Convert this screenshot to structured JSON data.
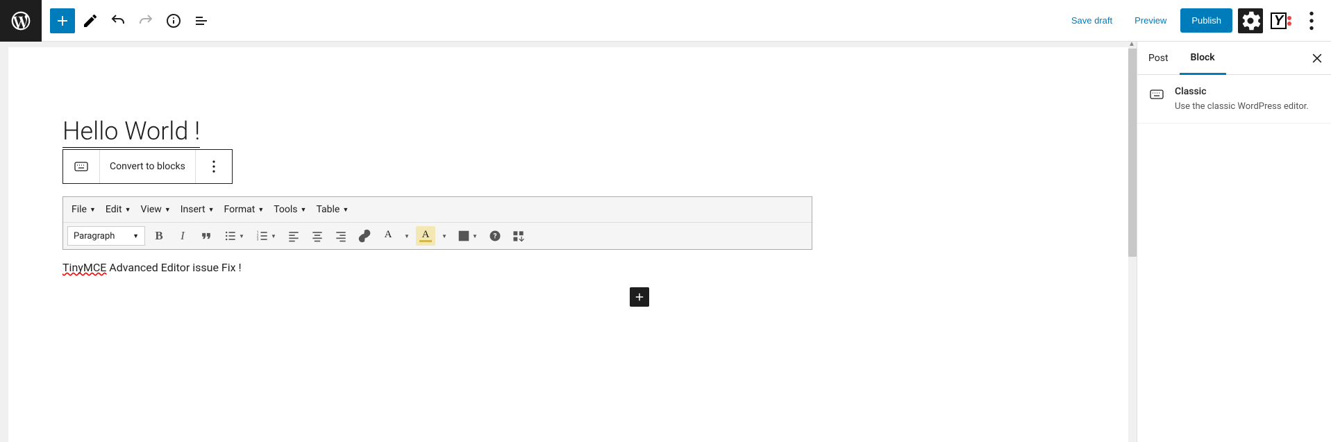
{
  "topbar": {
    "save_draft": "Save draft",
    "preview": "Preview",
    "publish": "Publish"
  },
  "editor": {
    "title": "Hello World !",
    "convert_label": "Convert to blocks",
    "body_spellerr": "TinyMCE",
    "body_rest": " Advanced Editor issue Fix !"
  },
  "mce": {
    "menus": [
      "File",
      "Edit",
      "View",
      "Insert",
      "Format",
      "Tools",
      "Table"
    ],
    "format_listbox": "Paragraph",
    "text_color": "#333333",
    "bg_color": "#f7e7a5"
  },
  "sidebar": {
    "tabs": {
      "post": "Post",
      "block": "Block"
    },
    "block": {
      "name": "Classic",
      "description": "Use the classic WordPress editor."
    }
  }
}
